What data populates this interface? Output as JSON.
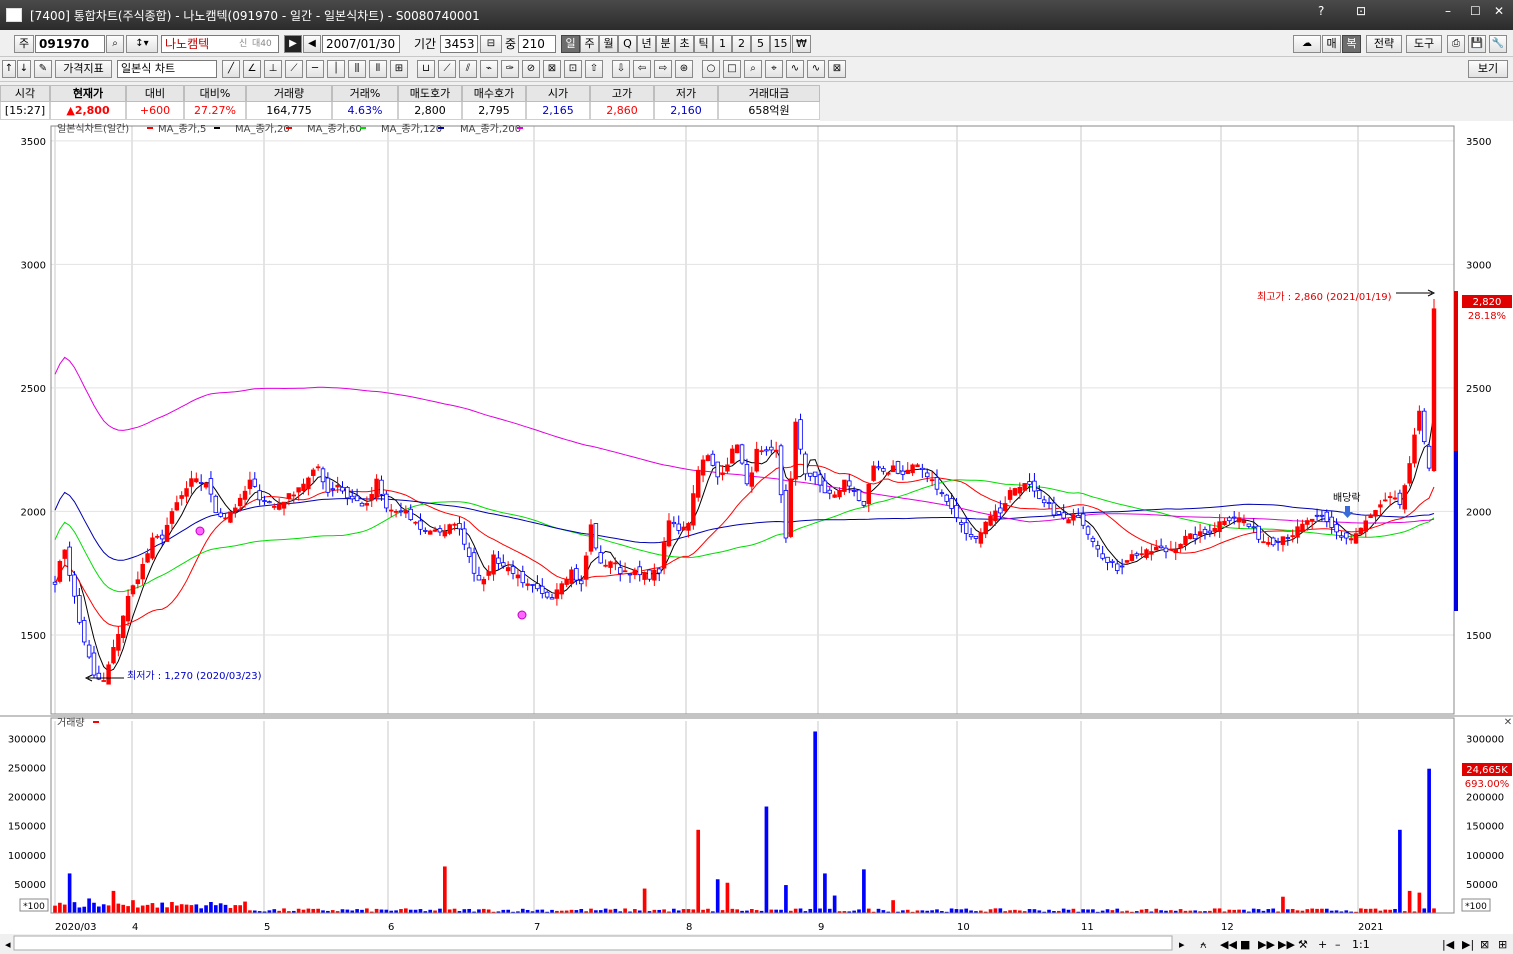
{
  "window": {
    "title": "[7400] 통합차트(주식종합) - 나노캠텍(091970 - 일간 - 일본식차트) - S0080740001",
    "controls": [
      "?",
      "⊡",
      "–",
      "☐",
      "✕"
    ]
  },
  "toolbar1": {
    "market_label": "주",
    "code": "091970",
    "name": "나노캠텍",
    "badges": [
      "신",
      "대40"
    ],
    "date": "2007/01/30",
    "period_label": "기간",
    "period_value": "3453",
    "view_label": "중",
    "view_value": "210",
    "intervals": [
      "일",
      "주",
      "월",
      "Q",
      "년",
      "분",
      "초",
      "틱",
      "1",
      "2",
      "5",
      "15",
      "₩"
    ],
    "selected_interval": "일",
    "right_buttons": [
      "매",
      "복",
      "전략",
      "도구"
    ]
  },
  "toolbar2": {
    "indicator_label": "가격지표",
    "chart_type": "일본식 차트",
    "view_button": "보기"
  },
  "quote": {
    "headers": [
      "시각",
      "현재가",
      "대비",
      "대비%",
      "거래량",
      "거래%",
      "매도호가",
      "매수호가",
      "시가",
      "고가",
      "저가",
      "거래대금"
    ],
    "values": [
      "[15:27]",
      "▲2,800",
      "+600",
      "27.27%",
      "164,775",
      "4.63%",
      "2,800",
      "2,795",
      "2,165",
      "2,860",
      "2,160",
      "658억원"
    ]
  },
  "colors": {
    "up": "#ff0000",
    "down": "#0000ff",
    "ma5": "#000000",
    "ma20": "#ff0000",
    "ma60": "#00dd00",
    "ma120": "#0000b0",
    "ma200": "#e000e0",
    "grid": "#c8c8c8"
  },
  "price_panel": {
    "legend": [
      "일본식차트(일간)",
      "MA_종가,5",
      "MA_종가,20",
      "MA_종가,60",
      "MA_종가,120",
      "MA_종가,200"
    ],
    "high_annotation": "최고가 : 2,860 (2021/01/19)",
    "low_annotation": "최저가 : 1,270 (2020/03/23)",
    "dividend_label": "배당락",
    "current_price_tag": "2,820",
    "current_change_tag": "28.18%"
  },
  "volume_panel": {
    "legend": "거래량",
    "scale_label": "*100",
    "current_volume_tag": "24,665K",
    "current_change_tag": "693.00%"
  },
  "chart_data": [
    {
      "type": "candlestick",
      "title": "일본식차트(일간)",
      "ylim": [
        1180,
        3560
      ],
      "yticks": [
        1500,
        2000,
        2500,
        3000,
        3500
      ],
      "x_labels": [
        "2020/03",
        "4",
        "5",
        "6",
        "7",
        "8",
        "9",
        "10",
        "11",
        "12",
        "2021"
      ],
      "grid": true,
      "control_points": [
        [
          0,
          1720
        ],
        [
          2,
          1850
        ],
        [
          5,
          1550
        ],
        [
          8,
          1330
        ],
        [
          10,
          1310
        ],
        [
          12,
          1440
        ],
        [
          15,
          1650
        ],
        [
          18,
          1780
        ],
        [
          20,
          1880
        ],
        [
          22,
          1900
        ],
        [
          25,
          2030
        ],
        [
          28,
          2120
        ],
        [
          31,
          2120
        ],
        [
          33,
          2000
        ],
        [
          35,
          1980
        ],
        [
          38,
          2040
        ],
        [
          40,
          2120
        ],
        [
          42,
          2060
        ],
        [
          45,
          2020
        ],
        [
          48,
          2060
        ],
        [
          50,
          2100
        ],
        [
          52,
          2130
        ],
        [
          54,
          2180
        ],
        [
          56,
          2080
        ],
        [
          58,
          2110
        ],
        [
          60,
          2060
        ],
        [
          62,
          2040
        ],
        [
          64,
          2020
        ],
        [
          66,
          2120
        ],
        [
          68,
          2010
        ],
        [
          70,
          2000
        ],
        [
          72,
          1990
        ],
        [
          74,
          1950
        ],
        [
          76,
          1920
        ],
        [
          78,
          1930
        ],
        [
          80,
          1910
        ],
        [
          82,
          1960
        ],
        [
          84,
          1880
        ],
        [
          86,
          1760
        ],
        [
          88,
          1710
        ],
        [
          90,
          1820
        ],
        [
          92,
          1780
        ],
        [
          94,
          1760
        ],
        [
          96,
          1700
        ],
        [
          98,
          1690
        ],
        [
          100,
          1660
        ],
        [
          102,
          1660
        ],
        [
          104,
          1720
        ],
        [
          106,
          1760
        ],
        [
          108,
          1700
        ],
        [
          110,
          1940
        ],
        [
          112,
          1780
        ],
        [
          114,
          1800
        ],
        [
          116,
          1760
        ],
        [
          118,
          1760
        ],
        [
          120,
          1740
        ],
        [
          122,
          1740
        ],
        [
          124,
          1760
        ],
        [
          126,
          1960
        ],
        [
          128,
          1930
        ],
        [
          130,
          1960
        ],
        [
          132,
          2180
        ],
        [
          134,
          2220
        ],
        [
          136,
          2140
        ],
        [
          138,
          2200
        ],
        [
          140,
          2280
        ],
        [
          142,
          2100
        ],
        [
          144,
          2240
        ],
        [
          146,
          2230
        ],
        [
          148,
          2240
        ],
        [
          150,
          1900
        ],
        [
          152,
          2350
        ],
        [
          154,
          2160
        ],
        [
          156,
          2130
        ],
        [
          158,
          2080
        ],
        [
          160,
          2060
        ],
        [
          162,
          2120
        ],
        [
          164,
          2090
        ],
        [
          166,
          2010
        ],
        [
          168,
          2180
        ],
        [
          170,
          2150
        ],
        [
          172,
          2180
        ],
        [
          174,
          2150
        ],
        [
          176,
          2180
        ],
        [
          178,
          2170
        ],
        [
          180,
          2130
        ],
        [
          182,
          2070
        ],
        [
          184,
          2010
        ],
        [
          186,
          1940
        ],
        [
          188,
          1890
        ],
        [
          190,
          1920
        ],
        [
          192,
          1990
        ],
        [
          194,
          2000
        ],
        [
          196,
          2080
        ],
        [
          198,
          2110
        ],
        [
          200,
          2100
        ],
        [
          202,
          2040
        ],
        [
          204,
          2020
        ],
        [
          206,
          1980
        ],
        [
          208,
          1960
        ],
        [
          210,
          1990
        ],
        [
          212,
          1920
        ],
        [
          214,
          1860
        ],
        [
          216,
          1790
        ],
        [
          218,
          1770
        ],
        [
          220,
          1810
        ],
        [
          222,
          1830
        ],
        [
          224,
          1830
        ],
        [
          226,
          1850
        ],
        [
          228,
          1840
        ],
        [
          230,
          1860
        ],
        [
          232,
          1890
        ],
        [
          234,
          1900
        ],
        [
          236,
          1910
        ],
        [
          238,
          1940
        ],
        [
          240,
          1970
        ],
        [
          242,
          1980
        ],
        [
          244,
          1960
        ],
        [
          246,
          1920
        ],
        [
          248,
          1880
        ],
        [
          250,
          1880
        ],
        [
          252,
          1900
        ],
        [
          254,
          1910
        ],
        [
          256,
          1940
        ],
        [
          258,
          1970
        ],
        [
          260,
          1970
        ],
        [
          262,
          1930
        ],
        [
          264,
          1900
        ],
        [
          266,
          1890
        ],
        [
          268,
          1930
        ],
        [
          270,
          1980
        ],
        [
          272,
          2020
        ],
        [
          274,
          2050
        ],
        [
          276,
          2030
        ],
        [
          278,
          2180
        ],
        [
          280,
          2410
        ],
        [
          282,
          2180
        ],
        [
          283,
          2820
        ]
      ],
      "open": 2165,
      "high": 2860,
      "low": 2160,
      "last": 2820,
      "period_high": {
        "value": 2860,
        "date": "2021/01/19"
      },
      "period_low": {
        "value": 1270,
        "date": "2020/03/23"
      }
    },
    {
      "type": "bar",
      "title": "거래량",
      "unit": "*100",
      "ylim": [
        0,
        330000
      ],
      "yticks": [
        50000,
        100000,
        150000,
        200000,
        250000,
        300000
      ],
      "spikes": [
        [
          3,
          68000
        ],
        [
          7,
          25000
        ],
        [
          12,
          38000
        ],
        [
          16,
          22000
        ],
        [
          80,
          80000
        ],
        [
          121,
          42000
        ],
        [
          132,
          143000
        ],
        [
          136,
          58000
        ],
        [
          138,
          52000
        ],
        [
          146,
          183000
        ],
        [
          150,
          48000
        ],
        [
          156,
          312000
        ],
        [
          158,
          68000
        ],
        [
          160,
          30000
        ],
        [
          166,
          75000
        ],
        [
          172,
          22000
        ],
        [
          252,
          28000
        ],
        [
          276,
          143000
        ],
        [
          278,
          38000
        ],
        [
          280,
          35000
        ],
        [
          282,
          248000
        ]
      ]
    }
  ]
}
